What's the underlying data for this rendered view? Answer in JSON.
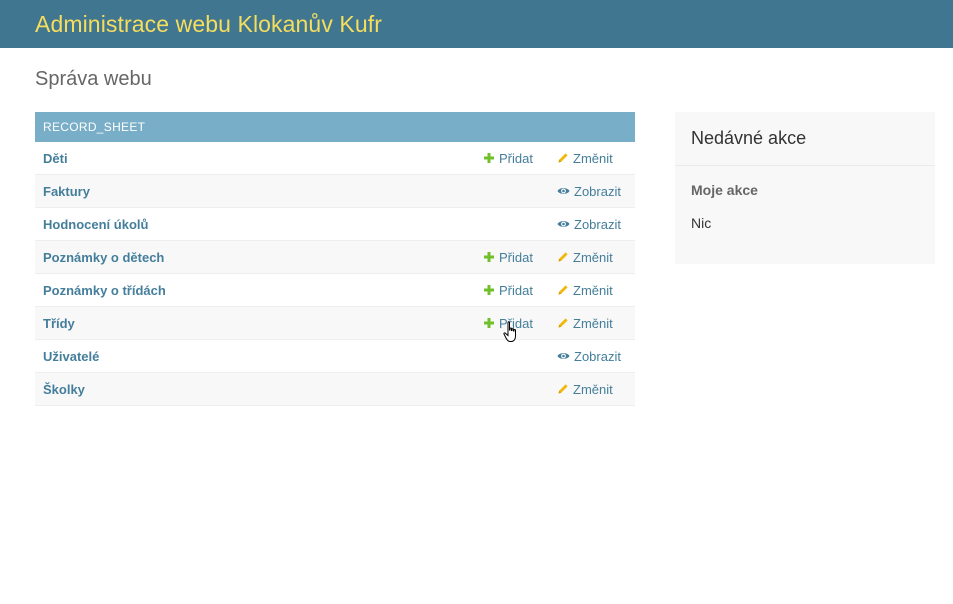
{
  "header": {
    "site_title": "Administrace webu Klokanův Kufr"
  },
  "page": {
    "title": "Správa webu"
  },
  "module": {
    "caption": "RECORD_SHEET",
    "rows": [
      {
        "name": "Děti",
        "add_label": "Přidat",
        "action_label": "Změnit",
        "action_type": "change"
      },
      {
        "name": "Faktury",
        "add_label": null,
        "action_label": "Zobrazit",
        "action_type": "view"
      },
      {
        "name": "Hodnocení úkolů",
        "add_label": null,
        "action_label": "Zobrazit",
        "action_type": "view"
      },
      {
        "name": "Poznámky o dětech",
        "add_label": "Přidat",
        "action_label": "Změnit",
        "action_type": "change"
      },
      {
        "name": "Poznámky o třídách",
        "add_label": "Přidat",
        "action_label": "Změnit",
        "action_type": "change"
      },
      {
        "name": "Třídy",
        "add_label": "Přidat",
        "action_label": "Změnit",
        "action_type": "change"
      },
      {
        "name": "Uživatelé",
        "add_label": null,
        "action_label": "Zobrazit",
        "action_type": "view"
      },
      {
        "name": "Školky",
        "add_label": null,
        "action_label": "Změnit",
        "action_type": "change"
      }
    ]
  },
  "sidebar": {
    "title": "Nedávné akce",
    "subtitle": "Moje akce",
    "empty_text": "Nic"
  },
  "colors": {
    "header_bg": "#417690",
    "title_yellow": "#f5dd5d",
    "caption_bg": "#79aec8",
    "link": "#447e9b",
    "add_green": "#70bf2b",
    "change_yellow": "#efb80b"
  },
  "icons": {
    "add": "plus-icon",
    "change": "pencil-icon",
    "view": "eye-icon",
    "cursor": "hand-pointer-cursor"
  }
}
